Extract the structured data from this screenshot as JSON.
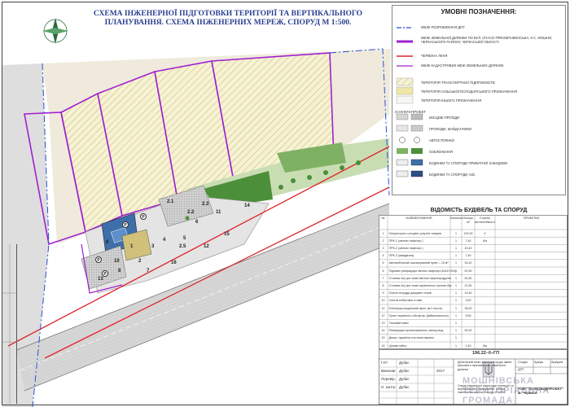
{
  "title": "СХЕМА ІНЖЕНЕРНОЇ ПІДГОТОВКИ ТЕРИТОРІЇ ТА ВЕРТИКАЛЬНОГО ПЛАНУВАННЯ. СХЕМА ІНЖЕНЕРНИХ МЕРЕЖ, СПОРУД М 1:500.",
  "legend": {
    "title": "УМОВНІ ПОЗНАЧЕННЯ:",
    "items": [
      "МЕЖІ РОЗРОБЛЕННЯ ДПТ",
      "МЕЖІ ЗЕМЕЛЬНОЇ ДІЛЯНКИ ПО ВУЛ. СПАСО-ПРЕОБРАЖЕНСЬКА, 8 С. МОШНИ, ЧЕРКАСЬКОГО РАЙОНУ, ЧЕРКАСЬКОЇ ОБЛАСТІ",
      "ЧЕРВОНА ЛІНІЯ",
      "МЕЖІ КАДАСТРОВИХ МЕЖ ЗЕМЕЛЬНИХ ДІЛЯНОК",
      "ТЕРИТОРІЯ ТРАНСПОРТНИХ ПІДПРИЄМСТВ",
      "ТЕРИТОРІЯ СІЛЬСЬКОГОСПОДАРСЬКОГО ПРИЗНАЧЕННЯ",
      "ТЕРИТОРІЯ ІНШОГО ПРИЗНАЧЕННЯ",
      "МІСЦЕВІ ПРОЇЗДИ",
      "ПРОХОДИ, МАЙДАНЧИКИ",
      "АВТОСТОЯНКИ",
      "ОЗЕЛЕНЕННЯ",
      "БУДИНКИ ТА СПОРУДИ ПРИВАТНОЇ ЗАБУДОВИ",
      "БУДИНКИ ТА СПОРУДИ АЗС"
    ],
    "col_existing": "ІСНУЮЧІ",
    "col_project": "ПРОЕКТ"
  },
  "table": {
    "title": "ВІДОМІСТЬ БУДІВЕЛЬ ТА СПОРУД",
    "headers": [
      "№",
      "НАЙМЕНУВАННЯ",
      "Кількість",
      "Площа, м²",
      "Ступінь вогнестійкості",
      "ПРИМІТКИ"
    ],
    "rows": [
      [
        "1",
        "Операторна з секцією супутніх товарів",
        "1",
        "120,00",
        "ІІ",
        ""
      ],
      [
        "2",
        "ПРК-1 (світлих нафтопр.)",
        "1",
        "7,40",
        "ІІІа",
        ""
      ],
      [
        "3",
        "ПРК-2 (світлих нафтопр.)",
        "1",
        "15,40",
        "",
        ""
      ],
      [
        "4",
        "ПРК-3 (швидкісна)",
        "1",
        "7,40",
        "",
        ""
      ],
      [
        "5",
        "Автомобільний газозаправний пункт – 10 м³",
        "1",
        "34,40",
        "",
        ""
      ],
      [
        "6",
        "Підземні резервуари світлих нафтопр.(40х2/+20х)",
        "1",
        "52,50",
        "",
        ""
      ],
      [
        "7",
        "Стоянка АЦ при зливі світлих нафтопродуктів",
        "1",
        "51,80",
        "",
        ""
      ],
      [
        "8",
        "Стоянка АЦ при зливі скрапленого пропан-бут",
        "1",
        "21,50",
        "",
        ""
      ],
      [
        "9",
        "Очисні споруди дощових стоків",
        "1",
        "14,40",
        "",
        ""
      ],
      [
        "10",
        "Септик побутових стоків",
        "1",
        "3,50",
        "",
        ""
      ],
      [
        "11",
        "Електророзподільний пункт (м.2 поста)",
        "1",
        "36,00",
        "",
        ""
      ],
      [
        "12",
        "Пункт сервісного обслугов. (мийка/пилосос)",
        "1",
        "5,50",
        "",
        ""
      ],
      [
        "13",
        "Тіньовий навіс",
        "1",
        "",
        "",
        ""
      ],
      [
        "14",
        "Резервуари протипожежного запасу вод.",
        "1",
        "90,00",
        "",
        ""
      ],
      [
        "15",
        "Декор. підсвітка логотипа мережі",
        "1",
        "",
        "",
        ""
      ],
      [
        "16",
        "Цінова табло",
        "1",
        "2,40",
        "ІІІа",
        ""
      ]
    ]
  },
  "stamp": {
    "code": "196.22–0–ГП",
    "project": "Детальний план території щодо зміни цільового призначення земельної ділянки",
    "sheet_title": "Схема інженерної підготовки території та вертикального планування. Схема інженерних мереж, споруд М 1:500",
    "stage_label": "Стадія",
    "sheet_label": "Аркуш",
    "sheets_label": "Аркушів",
    "stage": "ДПТ",
    "company": "ТОВ \"ТЕХНОБУДПРОЕКТ\" м. Черкаси",
    "gip_role": "Г.ІП",
    "gip_name": "Дубас",
    "dev_role": "Виконав",
    "dev_name": "Дубас",
    "chk_role": "Перевір.",
    "chk_name": "Дубас",
    "nc_role": "Н. контр.",
    "nc_name": "Дубас",
    "year": "2017"
  },
  "watermark": "МОШНІВСЬКА ТЕРИТОРІАЛЬНА ГРОМАДА",
  "map_labels": [
    "1",
    "2",
    "3",
    "4",
    "5",
    "6",
    "7",
    "8",
    "9",
    "10",
    "11",
    "12",
    "13",
    "14",
    "15",
    "16",
    "2.1",
    "2.2",
    "2.3",
    "2.5",
    "P",
    "P",
    "P",
    "P"
  ],
  "colors": {
    "red_line": "#e0232b",
    "parcel_boundary": "#a020d0",
    "dpt_boundary": "#2a4fd8",
    "greenery": "#4c8f3a",
    "light_green": "#c7dcb0",
    "hatch": "#e8e3b8",
    "road": "#d9d9d9",
    "title": "#2a3f8f"
  }
}
